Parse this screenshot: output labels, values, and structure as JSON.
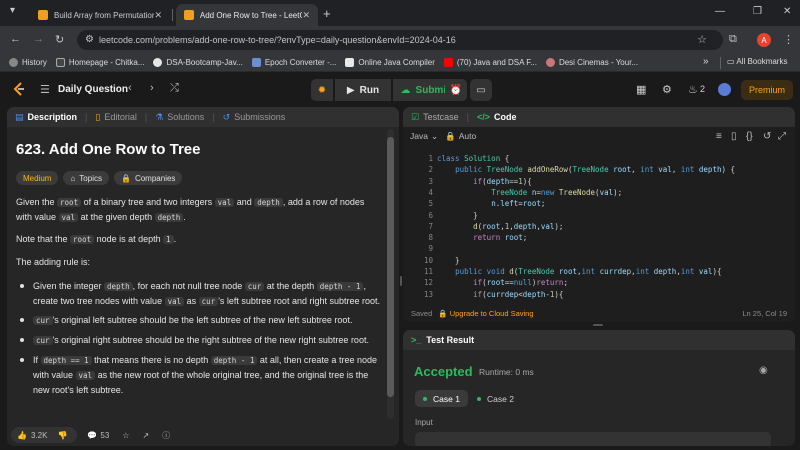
{
  "browser": {
    "tabs": [
      {
        "title": "Build Array from Permutation -",
        "active": false
      },
      {
        "title": "Add One Row to Tree - LeetCo",
        "active": true
      }
    ],
    "url": "leetcode.com/problems/add-one-row-to-tree/?envType=daily-question&envId=2024-04-16",
    "profile_initial": "A",
    "bookmarks": [
      {
        "label": "History",
        "icon": "history-icon"
      },
      {
        "label": "Homepage - Chitka...",
        "icon": "chitkara-icon"
      },
      {
        "label": "DSA-Bootcamp-Jav...",
        "icon": "github-icon"
      },
      {
        "label": "Epoch Converter -...",
        "icon": "epoch-icon"
      },
      {
        "label": "Online Java Compiler",
        "icon": "java-icon"
      },
      {
        "label": "(70) Java and DSA F...",
        "icon": "youtube-icon"
      },
      {
        "label": "Desi Cinemas - Your...",
        "icon": "desi-icon"
      }
    ],
    "all_bookmarks": "All Bookmarks"
  },
  "lcnav": {
    "title": "Daily Question",
    "run": "Run",
    "submit": "Submit",
    "streak": "2",
    "premium": "Premium"
  },
  "left": {
    "tabs": [
      "Description",
      "Editorial",
      "Solutions",
      "Submissions"
    ],
    "problem_title": "623. Add One Row to Tree",
    "chips": [
      "Medium",
      "Topics",
      "Companies"
    ],
    "p1": [
      "Given the ",
      "root",
      " of a binary tree and two integers ",
      "val",
      " and ",
      "depth",
      ", add a row of nodes with value ",
      "val",
      " at the given depth ",
      "depth",
      "."
    ],
    "p2": [
      "Note that the ",
      "root",
      " node is at depth ",
      "1",
      "."
    ],
    "p3": "The adding rule is:",
    "b1": [
      "Given the integer ",
      "depth",
      ", for each not null tree node ",
      "cur",
      " at the depth ",
      "depth - 1",
      ", create two tree nodes with value ",
      "val",
      " as ",
      "cur",
      "'s left subtree root and right subtree root."
    ],
    "b2": [
      "cur",
      "'s original left subtree should be the left subtree of the new left subtree root."
    ],
    "b3": [
      "cur",
      "'s original right subtree should be the right subtree of the new right subtree root."
    ],
    "b4": [
      "If ",
      "depth == 1",
      " that means there is no depth ",
      "depth - 1",
      " at all, then create a tree node with value ",
      "val",
      " as the new root of the whole original tree, and the original tree is the new root's left subtree."
    ],
    "likes": "3.2K",
    "comments": "53"
  },
  "right": {
    "tabs": [
      "Testcase",
      "Code"
    ],
    "language": "Java",
    "mode": "Auto",
    "code_lines": [
      {
        "n": "1",
        "t": "class Solution {"
      },
      {
        "n": "2",
        "t": "    public TreeNode addOneRow(TreeNode root, int val, int depth) {"
      },
      {
        "n": "3",
        "t": "        if(depth==1){"
      },
      {
        "n": "4",
        "t": "            TreeNode n=new TreeNode(val);"
      },
      {
        "n": "5",
        "t": "            n.left=root;"
      },
      {
        "n": "6",
        "t": "        }"
      },
      {
        "n": "7",
        "t": "        d(root,1,depth,val);"
      },
      {
        "n": "8",
        "t": "        return root;"
      },
      {
        "n": "9",
        "t": ""
      },
      {
        "n": "10",
        "t": "    }"
      },
      {
        "n": "11",
        "t": "    public void d(TreeNode root,int currdep,int depth,int val){"
      },
      {
        "n": "12",
        "t": "        if(root==null)return;"
      },
      {
        "n": "13",
        "t": "        if(currdep<depth-1){"
      }
    ],
    "saved": "Saved",
    "upgrade": "Upgrade to Cloud Saving",
    "cursor_pos": "Ln 25, Col 19"
  },
  "test": {
    "title": "Test Result",
    "status": "Accepted",
    "runtime": "Runtime: 0 ms",
    "cases": [
      "Case 1",
      "Case 2"
    ],
    "input_label": "Input"
  },
  "colors": {
    "accent": "#ffa116",
    "success": "#2cbb5d",
    "medium": "#ffb800"
  }
}
